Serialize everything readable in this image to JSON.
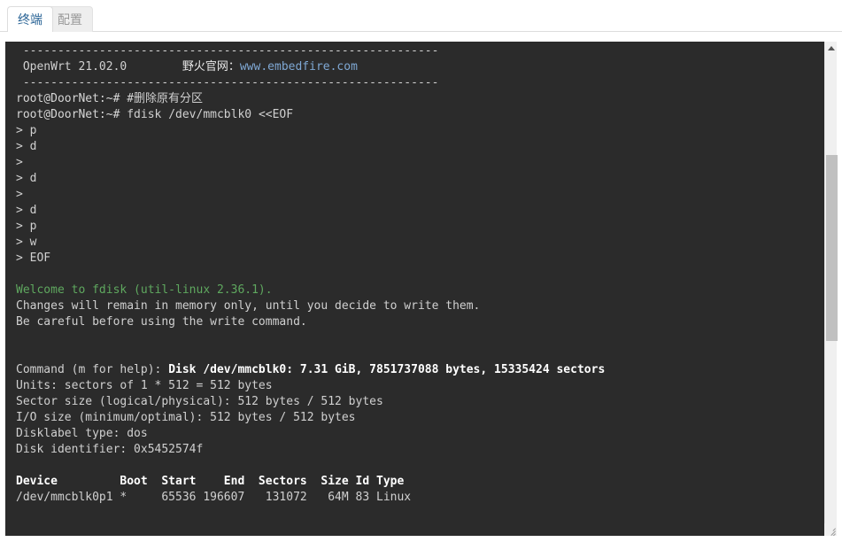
{
  "tabs": [
    {
      "label": "终端",
      "name": "tab-terminal",
      "active": true
    },
    {
      "label": "配置",
      "name": "tab-config",
      "active": false
    }
  ],
  "colors": {
    "terminal_bg": "#2b2b2b",
    "terminal_fg": "#d6d6d6",
    "accent_blue": "#2a6496",
    "url_blue": "#7fa8d4",
    "green": "#5fa85f",
    "scrollbar_track": "#f0f0f0",
    "scrollbar_thumb": "#c0c0c0"
  },
  "terminal": {
    "banner": {
      "rule": "------------------------------------------------------------",
      "distro": " OpenWrt 21.02.0",
      "gap": "        ",
      "vendor_label": "野火官网：",
      "vendor_url": "www.embedfire.com"
    },
    "lines": [
      {
        "type": "rule",
        "text": "------------------------------------------------------------"
      },
      {
        "type": "banner",
        "text": " OpenWrt 21.02.0        野火官网：www.embedfire.com"
      },
      {
        "type": "rule",
        "text": "------------------------------------------------------------"
      },
      {
        "type": "prompt",
        "prompt": "root@DoorNet:~# ",
        "text": "#删除原有分区"
      },
      {
        "type": "prompt",
        "prompt": "root@DoorNet:~# ",
        "text": "fdisk /dev/mmcblk0 <<EOF"
      },
      {
        "type": "cont",
        "text": "> p"
      },
      {
        "type": "cont",
        "text": "> d"
      },
      {
        "type": "cont",
        "text": "> "
      },
      {
        "type": "cont",
        "text": "> d"
      },
      {
        "type": "cont",
        "text": "> "
      },
      {
        "type": "cont",
        "text": "> d"
      },
      {
        "type": "cont",
        "text": "> p"
      },
      {
        "type": "cont",
        "text": "> w"
      },
      {
        "type": "cont",
        "text": "> EOF"
      },
      {
        "type": "blank",
        "text": ""
      },
      {
        "type": "green",
        "text": "Welcome to fdisk (util-linux 2.36.1)."
      },
      {
        "type": "plain",
        "text": "Changes will remain in memory only, until you decide to write them."
      },
      {
        "type": "plain",
        "text": "Be careful before using the write command."
      },
      {
        "type": "blank",
        "text": ""
      },
      {
        "type": "blank",
        "text": ""
      },
      {
        "type": "mixed",
        "plain": "Command (m for help): ",
        "bold": "Disk /dev/mmcblk0: 7.31 GiB, 7851737088 bytes, 15335424 sectors"
      },
      {
        "type": "plain",
        "text": "Units: sectors of 1 * 512 = 512 bytes"
      },
      {
        "type": "plain",
        "text": "Sector size (logical/physical): 512 bytes / 512 bytes"
      },
      {
        "type": "plain",
        "text": "I/O size (minimum/optimal): 512 bytes / 512 bytes"
      },
      {
        "type": "plain",
        "text": "Disklabel type: dos"
      },
      {
        "type": "plain",
        "text": "Disk identifier: 0x5452574f"
      },
      {
        "type": "blank",
        "text": ""
      },
      {
        "type": "bold",
        "text": "Device         Boot  Start    End  Sectors  Size Id Type"
      },
      {
        "type": "plain",
        "text": "/dev/mmcblk0p1 *     65536 196607   131072   64M 83 Linux"
      }
    ],
    "partition_table": {
      "headers": [
        "Device",
        "Boot",
        "Start",
        "End",
        "Sectors",
        "Size",
        "Id",
        "Type"
      ],
      "rows": [
        [
          "/dev/mmcblk0p1",
          "*",
          "65536",
          "196607",
          "131072",
          "64M",
          "83",
          "Linux"
        ]
      ]
    },
    "disk_info": {
      "device": "/dev/mmcblk0",
      "size_human": "7.31 GiB",
      "size_bytes": "7851737088 bytes",
      "sectors": "15335424 sectors",
      "units": "sectors of 1 * 512 = 512 bytes",
      "sector_size": "512 bytes / 512 bytes",
      "io_size": "512 bytes / 512 bytes",
      "disklabel_type": "dos",
      "disk_identifier": "0x5452574f"
    }
  },
  "scrollbar": {
    "up_arrow": "scroll-up",
    "down_arrow": "scroll-down",
    "thumb": "scroll-thumb",
    "grip": "resize-grip"
  }
}
